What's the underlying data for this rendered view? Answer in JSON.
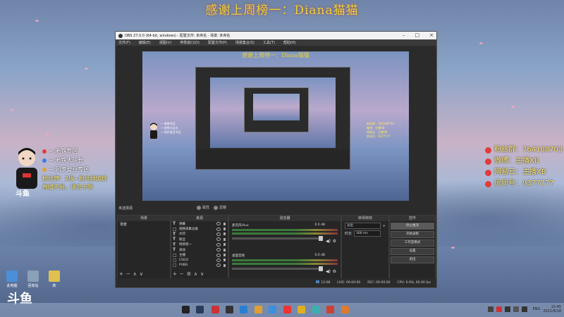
{
  "banner": {
    "text": "感谢上周榜一：Diana猫猫"
  },
  "left_overlay": {
    "items": [
      {
        "label": "~:老铁专区",
        "icon_color": "#e23a3a"
      },
      {
        "label": "~:老铁大队长",
        "icon_color": "#3a7fe2"
      },
      {
        "label": "~:同步爱豆专区",
        "icon_color": "#e2a23a"
      }
    ],
    "note_line1": "粉丝牌：2级~粉丝群加群",
    "note_line2": "直播不易，请勿卡顿",
    "logo_text": "斗鱼"
  },
  "right_overlay": {
    "items": [
      {
        "label": "粉丝群：764188703"
      },
      {
        "label": "微博：主播XB"
      },
      {
        "label": "网易云：主播XB"
      },
      {
        "label": "房间号：9377777"
      }
    ]
  },
  "desktop_icons": [
    {
      "label": "此电脑",
      "color": "#4a8fd8"
    },
    {
      "label": "回收站",
      "color": "#8aa0b8"
    },
    {
      "label": "新",
      "color": "#e0c050"
    }
  ],
  "desktop_logo": "斗鱼",
  "obs": {
    "title": "OBS 27.0.0 (64-bit, windows) - 配置文件: 未命名 - 场景: 未命名",
    "menu": [
      "文件(F)",
      "编辑(E)",
      "视图(V)",
      "停靠窗口(D)",
      "配置文件(P)",
      "场景集合(S)",
      "工具(T)",
      "帮助(H)"
    ],
    "preview_title": "感谢上周榜一：Diana猫猫",
    "scene_bar_label": "未选择源",
    "toggle_props": "属性",
    "toggle_filters": "滤镜",
    "docks": {
      "scenes_title": "场景",
      "sources_title": "来源",
      "mixer_title": "混音器",
      "transitions_title": "转场特效",
      "controls_title": "控件"
    },
    "scenes": [
      "场景"
    ],
    "sources": [
      {
        "icon": "T",
        "name": "弹幕"
      },
      {
        "icon": "□",
        "name": "视频采集设备"
      },
      {
        "icon": "T",
        "name": "水印"
      },
      {
        "icon": "T",
        "name": "粉丝"
      },
      {
        "icon": "T",
        "name": "周榜第一"
      },
      {
        "icon": "T",
        "name": "滚动"
      },
      {
        "icon": "□",
        "name": "主播"
      },
      {
        "icon": "▢",
        "name": "CSGO"
      },
      {
        "icon": "▢",
        "name": "PUBG"
      }
    ],
    "mixer": [
      {
        "name": "麦克风/Aux",
        "db": "0.0 dB"
      },
      {
        "name": "桌面音频",
        "db": "0.0 dB"
      }
    ],
    "transition": {
      "type": "淡出",
      "duration_label": "时长",
      "duration_value": "300 ms"
    },
    "controls": [
      "停止推流",
      "开始录制",
      "工作室模式",
      "设置",
      "退出"
    ],
    "status": {
      "live_label": "LIVE: 00:00:00",
      "rec_label": "REC: 00:00:00",
      "cpu_label": "CPU: 0.9%, 60.00 fps",
      "dropped": "12:08"
    }
  },
  "taskbar": {
    "apps": [
      {
        "name": "qq-icon",
        "color": "#222"
      },
      {
        "name": "steam-icon",
        "color": "#2a3a5a"
      },
      {
        "name": "netease-icon",
        "color": "#c33"
      },
      {
        "name": "wegame-icon",
        "color": "#e3a33a"
      },
      {
        "name": "obs-icon",
        "color": "#333"
      },
      {
        "name": "edge-icon",
        "color": "#2a7fd0"
      },
      {
        "name": "folder-icon",
        "color": "#e0a030"
      },
      {
        "name": "cloud-icon",
        "color": "#3a8fe0"
      },
      {
        "name": "douyu-icon",
        "color": "#e33"
      },
      {
        "name": "game-icon",
        "color": "#e0b020"
      },
      {
        "name": "browser-icon",
        "color": "#3ab0b0"
      },
      {
        "name": "chrome-icon",
        "color": "#d04030"
      },
      {
        "name": "tool-icon",
        "color": "#e07a30"
      }
    ],
    "tray_lang": "ENG",
    "clock_time": "15:45",
    "clock_date": "2021/6/18"
  }
}
